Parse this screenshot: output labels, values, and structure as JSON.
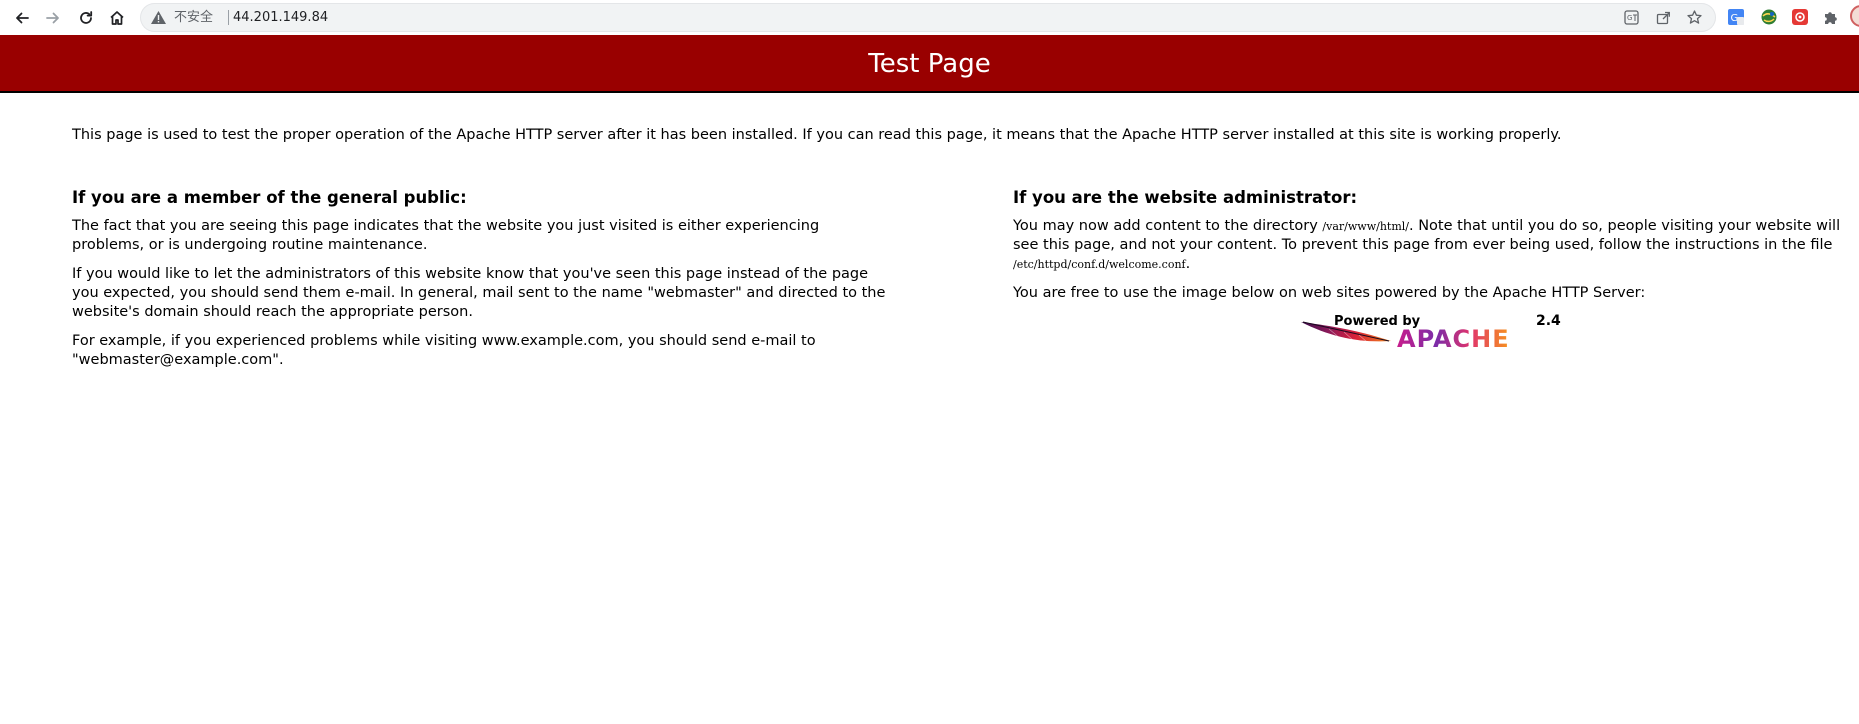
{
  "browser": {
    "insecure_label": "不安全",
    "url": "44.201.149.84",
    "colors": {
      "toolbar_bg": "#ffffff",
      "omnibox_bg": "#f1f3f4"
    },
    "icons": [
      "back-arrow-icon",
      "forward-arrow-icon",
      "reload-icon",
      "home-icon",
      "warning-icon",
      "translate-icon",
      "share-icon",
      "star-icon",
      "puzzle-icon"
    ]
  },
  "page": {
    "title": "Test Page",
    "header_color": "#990000",
    "intro": "This page is used to test the proper operation of the Apache HTTP server after it has been installed. If you can read this page, it means that the Apache HTTP server installed at this site is working properly.",
    "left": {
      "heading": "If you are a member of the general public:",
      "p1": "The fact that you are seeing this page indicates that the website you just visited is either experiencing problems, or is undergoing routine maintenance.",
      "p2": "If you would like to let the administrators of this website know that you've seen this page instead of the page you expected, you should send them e-mail. In general, mail sent to the name \"webmaster\" and directed to the website's domain should reach the appropriate person.",
      "p3": "For example, if you experienced problems while visiting www.example.com, you should send e-mail to \"webmaster@example.com\"."
    },
    "right": {
      "heading": "If you are the website administrator:",
      "p1_a": "You may now add content to the directory ",
      "p1_dir": "/var/www/html/",
      "p1_b": ". Note that until you do so, people visiting your website will see this page, and not your content. To prevent this page from ever being used, follow the instructions in the file ",
      "p1_file": "/etc/httpd/conf.d/welcome.conf",
      "p1_c": ".",
      "p2": "You are free to use the image below on web sites powered by the Apache HTTP Server:",
      "logo": {
        "powered_by": "Powered by",
        "version": "2.4",
        "brand": "APACHE"
      }
    }
  }
}
